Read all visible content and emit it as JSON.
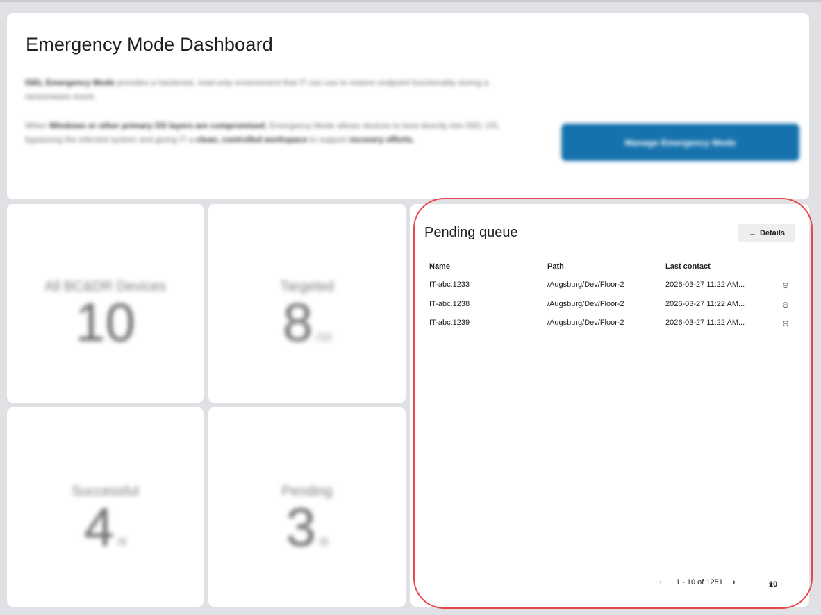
{
  "hero": {
    "title": "Emergency Mode Dashboard",
    "para1_bold": "ISEL Emergency Mode",
    "para1_rest": " provides a hardened, read-only environment that IT can use to restore endpoint functionality during a ransomware event.",
    "para2_a": "When ",
    "para2_b": "Windows or other primary OS layers are compromised",
    "para2_c": ", Emergency Mode allows devices to boot directly into ISEL OS, bypassing the infected system and giving IT a ",
    "para2_d": "clean, controlled workspace",
    "para2_e": " to support ",
    "para2_f": "recovery efforts.",
    "manage_button": "Manage Emergency Mode",
    "accent_color": "#1672ad"
  },
  "tiles": {
    "all": {
      "label": "All BC&DR Devices",
      "value": "10",
      "of": ""
    },
    "targeted": {
      "label": "Targeted",
      "value": "8",
      "of": "/10"
    },
    "successful": {
      "label": "Successful",
      "value": "4",
      "of": "/8"
    },
    "pending": {
      "label": "Pending",
      "value": "3",
      "of": "/8"
    }
  },
  "queue": {
    "title": "Pending queue",
    "details_label": "Details",
    "columns": {
      "name": "Name",
      "path": "Path",
      "contact": "Last contact"
    },
    "rows": [
      {
        "name": "IT-abc.1233",
        "path": "/Augsburg/Dev/Floor-2",
        "contact": "2026-03-27 11:22 AM..."
      },
      {
        "name": "IT-abc.1238",
        "path": "/Augsburg/Dev/Floor-2",
        "contact": "2026-03-27 11:22 AM..."
      },
      {
        "name": "IT-abc.1239",
        "path": "/Augsburg/Dev/Floor-2",
        "contact": "2026-03-27 11:22 AM..."
      }
    ],
    "pager": {
      "range": "1 - 10 of 1251",
      "page_size": "10"
    }
  },
  "highlight_color": "#e8484b"
}
